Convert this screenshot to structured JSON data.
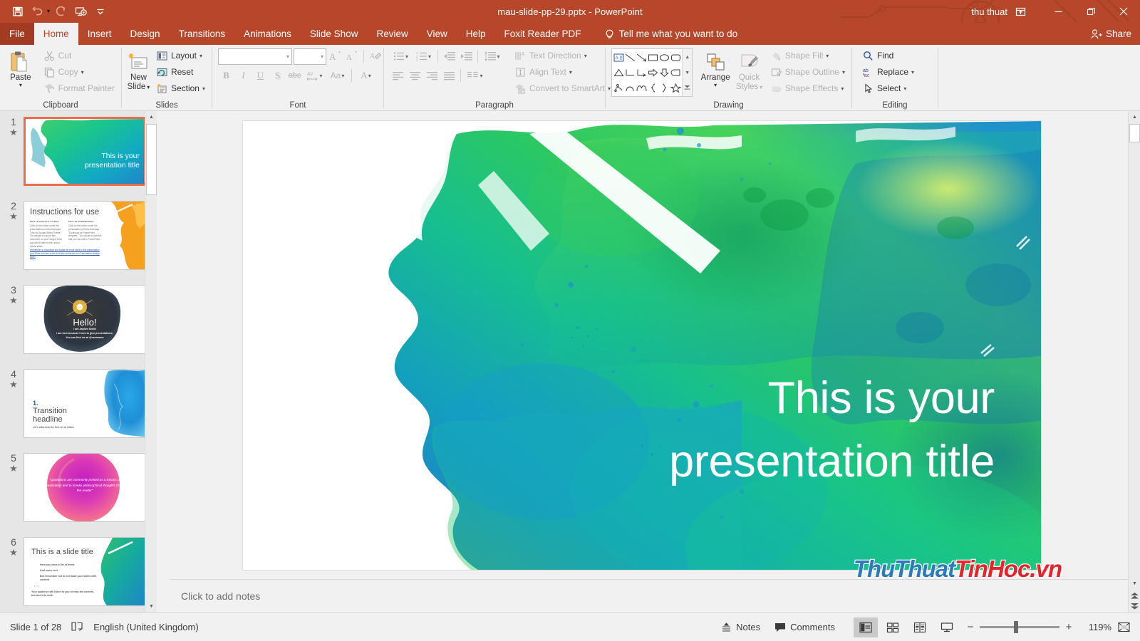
{
  "window": {
    "title": "mau-slide-pp-29.pptx  -  PowerPoint",
    "account": "thu thuat",
    "accent_color": "#b7472a",
    "minimize_glyph": "—",
    "restore_glyph": "❐",
    "close_glyph": "✕",
    "ribbon_display_icon": "ribbon-display-options-icon"
  },
  "qat": {
    "items": [
      {
        "name": "save-icon",
        "label": "Save",
        "dim": false
      },
      {
        "name": "undo-icon",
        "label": "Undo",
        "dim": true
      },
      {
        "name": "redo-icon",
        "label": "Redo",
        "dim": true
      },
      {
        "name": "start-from-beginning-icon",
        "label": "Start From Beginning",
        "dim": false
      },
      {
        "name": "customize-quick-access-toolbar-icon",
        "label": "Customize Quick Access Toolbar",
        "dim": false
      }
    ]
  },
  "tabs": {
    "file_label": "File",
    "items": [
      {
        "label": "Home",
        "active": true
      },
      {
        "label": "Insert",
        "active": false
      },
      {
        "label": "Design",
        "active": false
      },
      {
        "label": "Transitions",
        "active": false
      },
      {
        "label": "Animations",
        "active": false
      },
      {
        "label": "Slide Show",
        "active": false
      },
      {
        "label": "Review",
        "active": false
      },
      {
        "label": "View",
        "active": false
      },
      {
        "label": "Help",
        "active": false
      },
      {
        "label": "Foxit Reader PDF",
        "active": false
      }
    ],
    "tell_me": "Tell me what you want to do",
    "share_label": "Share"
  },
  "ribbon": {
    "clipboard": {
      "label": "Clipboard",
      "paste_label": "Paste",
      "items": [
        {
          "label": "Cut",
          "icon": "scissors-icon",
          "dim": true
        },
        {
          "label": "Copy",
          "icon": "copy-icon",
          "dim": true
        },
        {
          "label": "Format Painter",
          "icon": "format-painter-icon",
          "dim": true
        }
      ]
    },
    "slides": {
      "label": "Slides",
      "new_slide_label": "New\nSlide",
      "new_slide_line1": "New",
      "new_slide_line2": "Slide",
      "items": [
        {
          "label": "Layout",
          "icon": "layout-icon",
          "caret": true
        },
        {
          "label": "Reset",
          "icon": "reset-icon",
          "caret": false
        },
        {
          "label": "Section",
          "icon": "section-icon",
          "caret": true
        }
      ]
    },
    "font": {
      "label": "Font",
      "font_name_value": "",
      "font_name_placeholder": "",
      "font_size_value": "",
      "grow_font": "Increase Font Size",
      "shrink_font": "Decrease Font Size",
      "clear_formatting": "Clear All Formatting",
      "row2": [
        {
          "label": "B",
          "name": "bold-button"
        },
        {
          "label": "I",
          "name": "italic-button"
        },
        {
          "label": "U",
          "name": "underline-button"
        },
        {
          "label": "S",
          "name": "text-shadow-button"
        },
        {
          "label": "abc",
          "name": "strikethrough-button"
        },
        {
          "label": "AV",
          "name": "character-spacing-button"
        },
        {
          "label": "Aa",
          "name": "change-case-button"
        },
        {
          "label": "A",
          "name": "font-color-button"
        }
      ]
    },
    "paragraph": {
      "label": "Paragraph",
      "items": [
        {
          "label": "Text Direction",
          "icon": "text-direction-icon",
          "caret": true
        },
        {
          "label": "Align Text",
          "icon": "align-text-icon",
          "caret": true
        },
        {
          "label": "Convert to SmartArt",
          "icon": "convert-to-smartart-icon",
          "caret": true
        }
      ]
    },
    "drawing": {
      "label": "Drawing",
      "arrange_label": "Arrange",
      "quick_styles_line1": "Quick",
      "quick_styles_line2": "Styles",
      "items": [
        {
          "label": "Shape Fill",
          "icon": "shape-fill-icon",
          "caret": true
        },
        {
          "label": "Shape Outline",
          "icon": "shape-outline-icon",
          "caret": true
        },
        {
          "label": "Shape Effects",
          "icon": "shape-effects-icon",
          "caret": true
        }
      ],
      "shapes": [
        "textbox-shape",
        "line-shape",
        "arrow-shape",
        "rectangle-shape",
        "oval-shape",
        "rounded-rectangle-shape",
        "triangle-shape",
        "elbow-connector-shape",
        "elbow-arrow-connector-shape",
        "right-arrow-shape",
        "down-arrow-shape",
        "flowchart-shape",
        "scribble-shape",
        "arc-shape",
        "curve-shape",
        "left-brace-shape",
        "right-brace-shape",
        "star-shape"
      ]
    },
    "editing": {
      "label": "Editing",
      "items": [
        {
          "label": "Find",
          "icon": "find-icon",
          "caret": false
        },
        {
          "label": "Replace",
          "icon": "replace-icon",
          "caret": true
        },
        {
          "label": "Select",
          "icon": "select-icon",
          "caret": true
        }
      ]
    }
  },
  "thumbnails": {
    "selected_index": 1,
    "slides": [
      {
        "number": "1",
        "star": "★",
        "kind": "title-green",
        "title_line1": "This is your",
        "title_line2": "presentation title"
      },
      {
        "number": "2",
        "star": "★",
        "kind": "instructions",
        "title": "Instructions for use",
        "col1_head": "EDIT IN GOOGLE SLIDES",
        "col2_head": "EDIT IN POWERPOINT",
        "col1_body": "Click on the button under the presentation preview that says \"Use as Google Slides Theme\". You will get a copy of this document on your Google Drive and will be able to edit, add or delete slides.",
        "col2_body": "Click on the button under the presentation preview that says \"Download as PowerPoint template\". You will get a .pptx file that you can edit in PowerPoint.",
        "link_text": "Remember to download and install the fonts used in this presentation (you'll find the links to the font files needed in the Presentation design slide)"
      },
      {
        "number": "3",
        "star": "★",
        "kind": "hello",
        "title": "Hello!",
        "sub1": "I am Jayden Smith",
        "sub2": "I am here because I love to give presentations.",
        "sub3": "You can find me at @username"
      },
      {
        "number": "4",
        "star": "★",
        "kind": "transition",
        "num": "1.",
        "title_line1": "Transition",
        "title_line2": "headline",
        "sub": "Let's start with the first set of slides"
      },
      {
        "number": "5",
        "star": "★",
        "kind": "quote",
        "quote": "“Quotations are commonly printed as a means of inspiration and to invoke philosophical thoughts from the reader”"
      },
      {
        "number": "6",
        "star": "★",
        "kind": "bullets",
        "title": "This is a slide title",
        "bullets": [
          "Here you have a list of items",
          "And some text",
          "But remember not to overload your slides with content"
        ],
        "footnote": "Your audience will listen to you or read the content, but won't do both."
      }
    ]
  },
  "slide": {
    "title_line1": "This is your",
    "title_line2": "presentation title",
    "title_color": "#ffffff"
  },
  "notes": {
    "placeholder": "Click to add notes"
  },
  "statusbar": {
    "slide_counter": "Slide 1 of 28",
    "language": "English (United Kingdom)",
    "accessibility_icon": "accessibility-checker-icon",
    "notes_label": "Notes",
    "comments_label": "Comments",
    "views": [
      {
        "name": "normal-view-button",
        "icon": "normal-view-icon",
        "active": true
      },
      {
        "name": "slide-sorter-view-button",
        "icon": "slide-sorter-icon",
        "active": false
      },
      {
        "name": "reading-view-button",
        "icon": "reading-view-icon",
        "active": false
      },
      {
        "name": "slide-show-button",
        "icon": "slide-show-icon",
        "active": false
      }
    ],
    "zoom_out": "−",
    "zoom_in": "+",
    "zoom_level": "119%",
    "fit_to_window_icon": "fit-slide-to-window-icon"
  },
  "watermark": {
    "blue_part": "ThuThuat",
    "red_part": "TinHoc.vn",
    "blue": "#2b7bba",
    "red": "#e8242a"
  }
}
